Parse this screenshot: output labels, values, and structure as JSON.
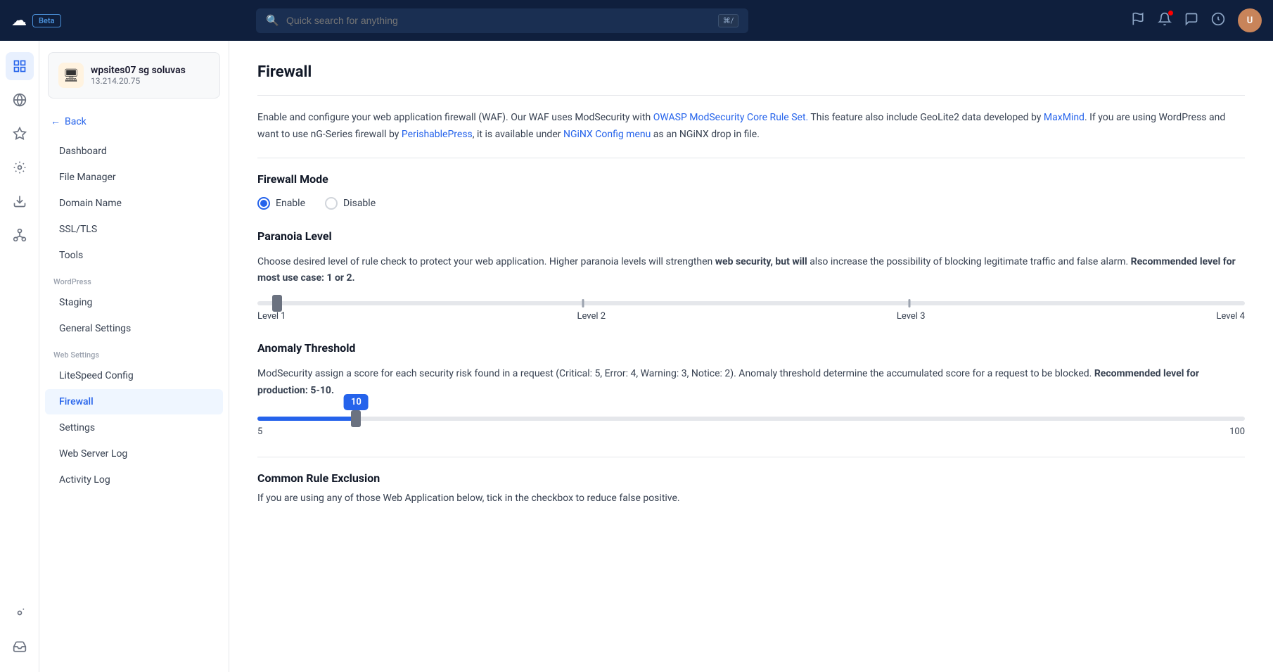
{
  "topnav": {
    "logo_text": "☁",
    "beta_label": "Beta",
    "search_placeholder": "Quick search for anything",
    "search_kbd": "⌘/",
    "icons": [
      "flag",
      "bell",
      "chat",
      "user-circle"
    ],
    "avatar_initials": "U"
  },
  "icon_sidebar": {
    "items": [
      {
        "name": "grid-icon",
        "glyph": "⊞",
        "active": true
      },
      {
        "name": "globe-icon",
        "glyph": "🌐",
        "active": false
      },
      {
        "name": "star-icon",
        "glyph": "✦",
        "active": false
      },
      {
        "name": "settings-group-icon",
        "glyph": "⚙",
        "active": false
      },
      {
        "name": "download-icon",
        "glyph": "⬇",
        "active": false
      },
      {
        "name": "network-icon",
        "glyph": "◈",
        "active": false
      }
    ]
  },
  "server": {
    "name": "wpsites07 sg soluvas",
    "ip": "13.214.20.75",
    "icon": "🖥"
  },
  "back_label": "Back",
  "nav": {
    "main_items": [
      {
        "label": "Dashboard",
        "active": false
      },
      {
        "label": "File Manager",
        "active": false
      },
      {
        "label": "Domain Name",
        "active": false
      },
      {
        "label": "SSL/TLS",
        "active": false
      },
      {
        "label": "Tools",
        "active": false
      }
    ],
    "wordpress_section": "WordPress",
    "wordpress_items": [
      {
        "label": "Staging",
        "active": false
      },
      {
        "label": "General Settings",
        "active": false
      }
    ],
    "web_settings_section": "Web Settings",
    "web_settings_items": [
      {
        "label": "LiteSpeed Config",
        "active": false
      },
      {
        "label": "Firewall",
        "active": true
      },
      {
        "label": "Settings",
        "active": false
      },
      {
        "label": "Web Server Log",
        "active": false
      },
      {
        "label": "Activity Log",
        "active": false
      }
    ]
  },
  "content": {
    "page_title": "Firewall",
    "description_parts": {
      "before_link1": "Enable and configure your web application firewall (WAF). Our WAF uses ModSecurity with ",
      "link1_text": "OWASP ModSecurity Core Rule Set.",
      "link1_href": "#",
      "after_link1": " This feature also include GeoLite2 data developed by ",
      "link2_text": "MaxMind",
      "link2_href": "#",
      "after_link2": ". If you are using WordPress and want to use nG-Series firewall by ",
      "link3_text": "PerishablePress",
      "link3_href": "#",
      "after_link3": ", it is available under ",
      "link4_text": "NGiNX Config menu",
      "link4_href": "#",
      "after_link4": " as an NGiNX drop in file."
    },
    "firewall_mode": {
      "title": "Firewall Mode",
      "options": [
        {
          "label": "Enable",
          "checked": true
        },
        {
          "label": "Disable",
          "checked": false
        }
      ]
    },
    "paranoia": {
      "title": "Paranoia Level",
      "description_before_bold": "Choose desired level of rule check to protect your web application. Higher paranoia levels will strengthen ",
      "bold_text": "web security, but will",
      "description_after_bold": " also increase the possibility of blocking legitimate traffic and false alarm. ",
      "recommended_bold": "Recommended level for most use case: 1 or 2.",
      "levels": [
        "Level 1",
        "Level 2",
        "Level 3",
        "Level 4"
      ],
      "current_value": 1,
      "thumb_pct": 2
    },
    "anomaly": {
      "title": "Anomaly Threshold",
      "description": "ModSecurity assign a score for each security risk found in a request (Critical: 5, Error: 4, Warning: 3, Notice: 2). Anomaly threshold determine the accumulated score for a request to be blocked. ",
      "recommended_bold": "Recommended level for production: 5-10.",
      "current_value": 10,
      "fill_pct": 10,
      "min": 5,
      "max": 100
    },
    "common_rule": {
      "title": "Common Rule Exclusion",
      "description": "If you are using any of those Web Application below, tick in the checkbox to reduce false positive."
    }
  }
}
